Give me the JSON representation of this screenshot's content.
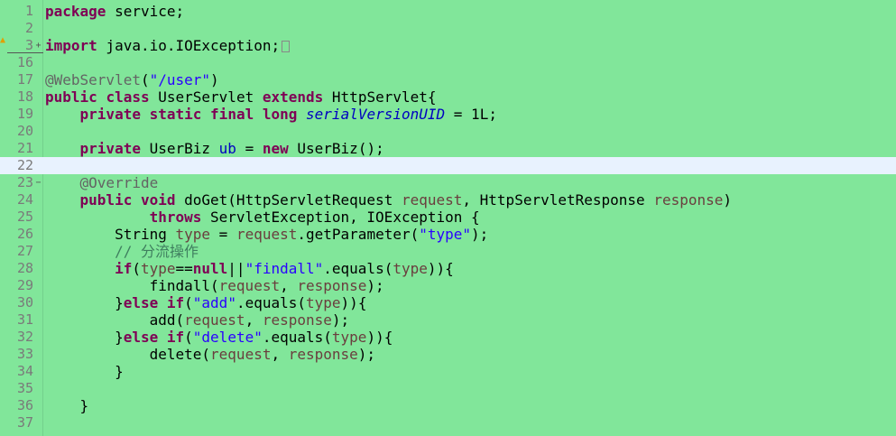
{
  "editor": {
    "background": "#81e69a",
    "current_line_color": "#e8f2fe",
    "lines": [
      {
        "num": "1",
        "fold": "",
        "tokens": [
          {
            "t": "kw",
            "v": "package"
          },
          {
            "t": "plain",
            "v": " service;"
          }
        ]
      },
      {
        "num": "2",
        "fold": "",
        "tokens": []
      },
      {
        "num": "3",
        "fold": "+",
        "tokens": [
          {
            "t": "kw",
            "v": "import"
          },
          {
            "t": "plain",
            "v": " java.io.IOException;"
          }
        ],
        "collapsed": true
      },
      {
        "num": "16",
        "fold": "",
        "tokens": []
      },
      {
        "num": "17",
        "fold": "",
        "tokens": [
          {
            "t": "ann",
            "v": "@WebServlet"
          },
          {
            "t": "plain",
            "v": "("
          },
          {
            "t": "str",
            "v": "\"/user\""
          },
          {
            "t": "plain",
            "v": ")"
          }
        ]
      },
      {
        "num": "18",
        "fold": "",
        "tokens": [
          {
            "t": "kw",
            "v": "public"
          },
          {
            "t": "plain",
            "v": " "
          },
          {
            "t": "kw",
            "v": "class"
          },
          {
            "t": "plain",
            "v": " UserServlet "
          },
          {
            "t": "kw",
            "v": "extends"
          },
          {
            "t": "plain",
            "v": " HttpServlet{"
          }
        ]
      },
      {
        "num": "19",
        "fold": "",
        "tokens": [
          {
            "t": "plain",
            "v": "    "
          },
          {
            "t": "kw",
            "v": "private"
          },
          {
            "t": "plain",
            "v": " "
          },
          {
            "t": "kw",
            "v": "static"
          },
          {
            "t": "plain",
            "v": " "
          },
          {
            "t": "kw",
            "v": "final"
          },
          {
            "t": "plain",
            "v": " "
          },
          {
            "t": "kw",
            "v": "long"
          },
          {
            "t": "plain",
            "v": " "
          },
          {
            "t": "field",
            "v": "serialVersionUID"
          },
          {
            "t": "plain",
            "v": " = 1L;"
          }
        ]
      },
      {
        "num": "20",
        "fold": "",
        "tokens": []
      },
      {
        "num": "21",
        "fold": "",
        "tokens": [
          {
            "t": "plain",
            "v": "    "
          },
          {
            "t": "kw",
            "v": "private"
          },
          {
            "t": "plain",
            "v": " UserBiz "
          },
          {
            "t": "fieldref",
            "v": "ub"
          },
          {
            "t": "plain",
            "v": " = "
          },
          {
            "t": "kw",
            "v": "new"
          },
          {
            "t": "plain",
            "v": " UserBiz();"
          }
        ]
      },
      {
        "num": "22",
        "fold": "",
        "tokens": [],
        "current": true
      },
      {
        "num": "23",
        "fold": "−",
        "tokens": [
          {
            "t": "plain",
            "v": "    "
          },
          {
            "t": "ann",
            "v": "@Override"
          }
        ]
      },
      {
        "num": "24",
        "fold": "",
        "tokens": [
          {
            "t": "plain",
            "v": "    "
          },
          {
            "t": "kw",
            "v": "public"
          },
          {
            "t": "plain",
            "v": " "
          },
          {
            "t": "kw",
            "v": "void"
          },
          {
            "t": "plain",
            "v": " doGet(HttpServletRequest "
          },
          {
            "t": "param",
            "v": "request"
          },
          {
            "t": "plain",
            "v": ", HttpServletResponse "
          },
          {
            "t": "param",
            "v": "response"
          },
          {
            "t": "plain",
            "v": ")"
          }
        ]
      },
      {
        "num": "25",
        "fold": "",
        "tokens": [
          {
            "t": "plain",
            "v": "            "
          },
          {
            "t": "kw",
            "v": "throws"
          },
          {
            "t": "plain",
            "v": " ServletException, IOException {"
          }
        ]
      },
      {
        "num": "26",
        "fold": "",
        "tokens": [
          {
            "t": "plain",
            "v": "        String "
          },
          {
            "t": "local",
            "v": "type"
          },
          {
            "t": "plain",
            "v": " = "
          },
          {
            "t": "param",
            "v": "request"
          },
          {
            "t": "plain",
            "v": ".getParameter("
          },
          {
            "t": "str",
            "v": "\"type\""
          },
          {
            "t": "plain",
            "v": ");"
          }
        ]
      },
      {
        "num": "27",
        "fold": "",
        "tokens": [
          {
            "t": "plain",
            "v": "        "
          },
          {
            "t": "cm",
            "v": "// 分流操作"
          }
        ]
      },
      {
        "num": "28",
        "fold": "",
        "tokens": [
          {
            "t": "plain",
            "v": "        "
          },
          {
            "t": "kw",
            "v": "if"
          },
          {
            "t": "plain",
            "v": "("
          },
          {
            "t": "local",
            "v": "type"
          },
          {
            "t": "plain",
            "v": "=="
          },
          {
            "t": "kw",
            "v": "null"
          },
          {
            "t": "plain",
            "v": "||"
          },
          {
            "t": "str",
            "v": "\"findall\""
          },
          {
            "t": "plain",
            "v": ".equals("
          },
          {
            "t": "local",
            "v": "type"
          },
          {
            "t": "plain",
            "v": ")){"
          }
        ]
      },
      {
        "num": "29",
        "fold": "",
        "tokens": [
          {
            "t": "plain",
            "v": "            findall("
          },
          {
            "t": "param",
            "v": "request"
          },
          {
            "t": "plain",
            "v": ", "
          },
          {
            "t": "param",
            "v": "response"
          },
          {
            "t": "plain",
            "v": ");"
          }
        ]
      },
      {
        "num": "30",
        "fold": "",
        "tokens": [
          {
            "t": "plain",
            "v": "        }"
          },
          {
            "t": "kw",
            "v": "else"
          },
          {
            "t": "plain",
            "v": " "
          },
          {
            "t": "kw",
            "v": "if"
          },
          {
            "t": "plain",
            "v": "("
          },
          {
            "t": "str",
            "v": "\"add\""
          },
          {
            "t": "plain",
            "v": ".equals("
          },
          {
            "t": "local",
            "v": "type"
          },
          {
            "t": "plain",
            "v": ")){"
          }
        ]
      },
      {
        "num": "31",
        "fold": "",
        "tokens": [
          {
            "t": "plain",
            "v": "            add("
          },
          {
            "t": "param",
            "v": "request"
          },
          {
            "t": "plain",
            "v": ", "
          },
          {
            "t": "param",
            "v": "response"
          },
          {
            "t": "plain",
            "v": ");"
          }
        ]
      },
      {
        "num": "32",
        "fold": "",
        "tokens": [
          {
            "t": "plain",
            "v": "        }"
          },
          {
            "t": "kw",
            "v": "else"
          },
          {
            "t": "plain",
            "v": " "
          },
          {
            "t": "kw",
            "v": "if"
          },
          {
            "t": "plain",
            "v": "("
          },
          {
            "t": "str",
            "v": "\"delete\""
          },
          {
            "t": "plain",
            "v": ".equals("
          },
          {
            "t": "local",
            "v": "type"
          },
          {
            "t": "plain",
            "v": ")){"
          }
        ]
      },
      {
        "num": "33",
        "fold": "",
        "tokens": [
          {
            "t": "plain",
            "v": "            delete("
          },
          {
            "t": "param",
            "v": "request"
          },
          {
            "t": "plain",
            "v": ", "
          },
          {
            "t": "param",
            "v": "response"
          },
          {
            "t": "plain",
            "v": ");"
          }
        ]
      },
      {
        "num": "34",
        "fold": "",
        "tokens": [
          {
            "t": "plain",
            "v": "        }"
          }
        ]
      },
      {
        "num": "35",
        "fold": "",
        "tokens": []
      },
      {
        "num": "36",
        "fold": "",
        "tokens": [
          {
            "t": "plain",
            "v": "    }"
          }
        ]
      },
      {
        "num": "37",
        "fold": "",
        "tokens": []
      }
    ]
  }
}
